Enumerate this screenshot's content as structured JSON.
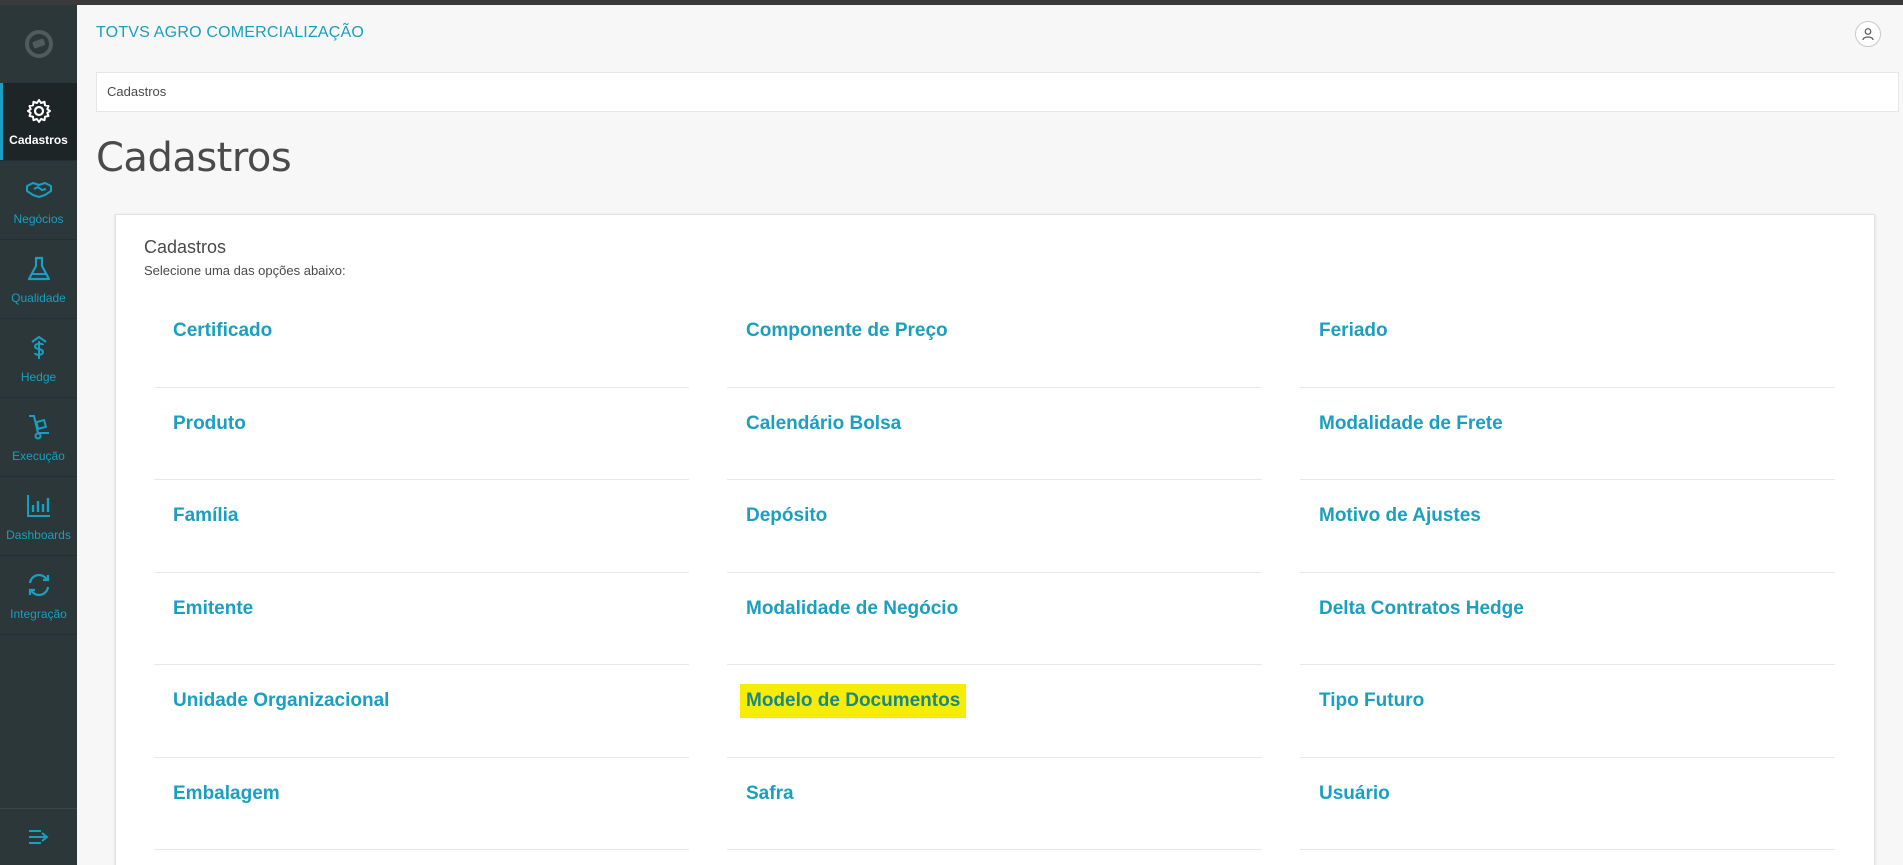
{
  "app": {
    "title": "TOTVS AGRO COMERCIALIZAÇÃO"
  },
  "sidebar": {
    "items": [
      {
        "label": "Cadastros",
        "icon": "gear-icon",
        "active": true
      },
      {
        "label": "Negócios",
        "icon": "handshake-icon",
        "active": false
      },
      {
        "label": "Qualidade",
        "icon": "flask-icon",
        "active": false
      },
      {
        "label": "Hedge",
        "icon": "dollar-icon",
        "active": false
      },
      {
        "label": "Execução",
        "icon": "hand-truck-icon",
        "active": false
      },
      {
        "label": "Dashboards",
        "icon": "bar-chart-icon",
        "active": false
      },
      {
        "label": "Integração",
        "icon": "sync-icon",
        "active": false
      }
    ]
  },
  "breadcrumb": {
    "label": "Cadastros"
  },
  "page": {
    "title": "Cadastros"
  },
  "card": {
    "title": "Cadastros",
    "subtitle": "Selecione uma das opções abaixo:"
  },
  "options": {
    "col1": [
      "Certificado",
      "Produto",
      "Família",
      "Emitente",
      "Unidade Organizacional",
      "Embalagem"
    ],
    "col2": [
      "Componente de Preço",
      "Calendário Bolsa",
      "Depósito",
      "Modalidade de Negócio",
      "Modelo de Documentos",
      "Safra"
    ],
    "col3": [
      "Feriado",
      "Modalidade de Frete",
      "Motivo de Ajustes",
      "Delta Contratos Hedge",
      "Tipo Futuro",
      "Usuário"
    ]
  },
  "highlighted_option": "Modelo de Documentos",
  "colors": {
    "accent": "#1a9fc0",
    "sidebar_bg": "#2c3739",
    "highlight": "#f7ec07"
  }
}
